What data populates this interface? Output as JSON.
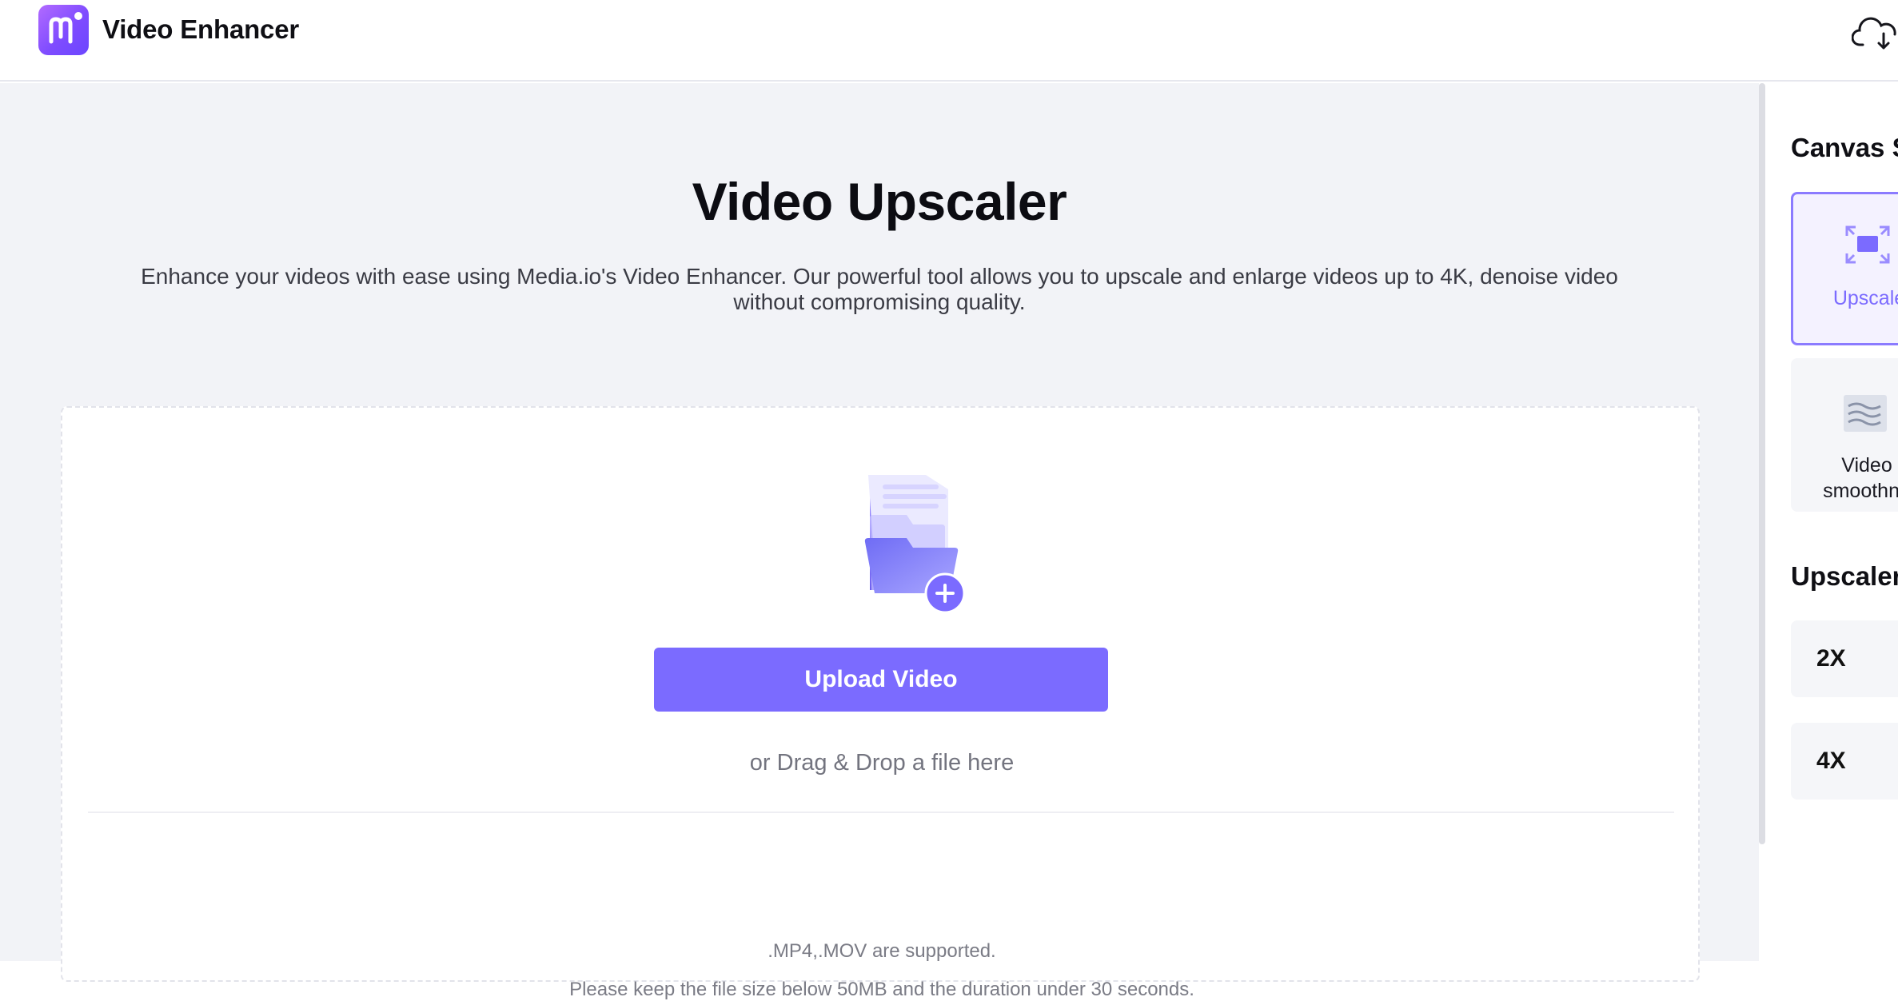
{
  "header": {
    "app_title": "Video Enhancer",
    "logo_icon": "mediaio-logo-icon",
    "cloud_icon": "cloud-download-icon"
  },
  "main": {
    "title": "Video Upscaler",
    "description": "Enhance your videos with ease using Media.io's Video Enhancer. Our powerful tool allows you to upscale and enlarge videos up to 4K, denoise video without compromising quality.",
    "upload": {
      "button_label": "Upload Video",
      "drag_hint": "or Drag & Drop a file here",
      "formats_note": ".MP4,.MOV are supported.",
      "limits_note": "Please keep the file size below 50MB and the duration under 30 seconds.",
      "illustration_icon": "folder-add-icon"
    }
  },
  "sidebar": {
    "section1_heading": "Canvas S",
    "options": [
      {
        "label": "Upscale",
        "icon": "upscale-icon",
        "active": true
      },
      {
        "label_line1": "Video",
        "label_line2": "smoothne",
        "icon": "smoothness-icon",
        "active": false
      }
    ],
    "section2_heading": "Upscaler",
    "scales": [
      "2X",
      "4X"
    ]
  },
  "colors": {
    "accent": "#7b6bff",
    "page_bg": "#f2f3f7",
    "card_bg": "#ffffff"
  }
}
